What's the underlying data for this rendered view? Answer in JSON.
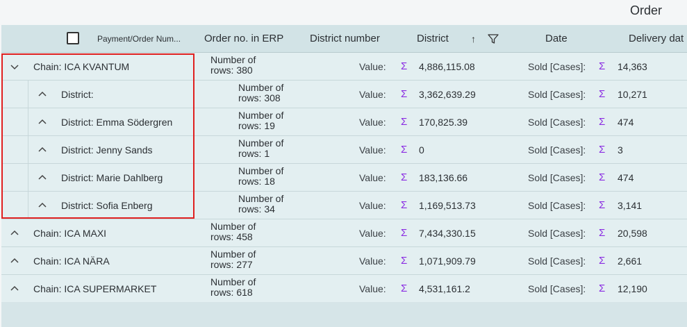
{
  "group_header": {
    "label": "Order"
  },
  "columns": {
    "payment": "Payment/Order Num...",
    "erp": "Order no. in ERP",
    "district_number": "District number",
    "district": "District",
    "date": "Date",
    "delivery": "Delivery dat"
  },
  "rows": [
    {
      "label": "Chain: ICA KVANTUM",
      "rows_line1": "Number of",
      "rows_line2": "rows: 380",
      "value_label": "Value:",
      "value": "4,886,115.08",
      "sold_label": "Sold [Cases]:",
      "sold": "14,363",
      "expanded": true
    },
    {
      "label": "District:",
      "rows_line1": "Number of",
      "rows_line2": "rows: 308",
      "value_label": "Value:",
      "value": "3,362,639.29",
      "sold_label": "Sold [Cases]:",
      "sold": "10,271"
    },
    {
      "label": "District: Emma Södergren",
      "rows_line1": "Number of",
      "rows_line2": "rows: 19",
      "value_label": "Value:",
      "value": "170,825.39",
      "sold_label": "Sold [Cases]:",
      "sold": "474"
    },
    {
      "label": "District: Jenny Sands",
      "rows_line1": "Number of",
      "rows_line2": "rows: 1",
      "value_label": "Value:",
      "value": "0",
      "sold_label": "Sold [Cases]:",
      "sold": "3"
    },
    {
      "label": "District: Marie Dahlberg",
      "rows_line1": "Number of",
      "rows_line2": "rows: 18",
      "value_label": "Value:",
      "value": "183,136.66",
      "sold_label": "Sold [Cases]:",
      "sold": "474"
    },
    {
      "label": "District: Sofia Enberg",
      "rows_line1": "Number of",
      "rows_line2": "rows: 34",
      "value_label": "Value:",
      "value": "1,169,513.73",
      "sold_label": "Sold [Cases]:",
      "sold": "3,141"
    },
    {
      "label": "Chain: ICA MAXI",
      "rows_line1": "Number of",
      "rows_line2": "rows: 458",
      "value_label": "Value:",
      "value": "7,434,330.15",
      "sold_label": "Sold [Cases]:",
      "sold": "20,598"
    },
    {
      "label": "Chain: ICA NÄRA",
      "rows_line1": "Number of",
      "rows_line2": "rows: 277",
      "value_label": "Value:",
      "value": "1,071,909.79",
      "sold_label": "Sold [Cases]:",
      "sold": "2,661"
    },
    {
      "label": "Chain: ICA SUPERMARKET",
      "rows_line1": "Number of",
      "rows_line2": "rows: 618",
      "value_label": "Value:",
      "value": "4,531,161.2",
      "sold_label": "Sold [Cases]:",
      "sold": "12,190"
    }
  ],
  "sigma_symbol": "Σ",
  "sort_symbol": "↑"
}
